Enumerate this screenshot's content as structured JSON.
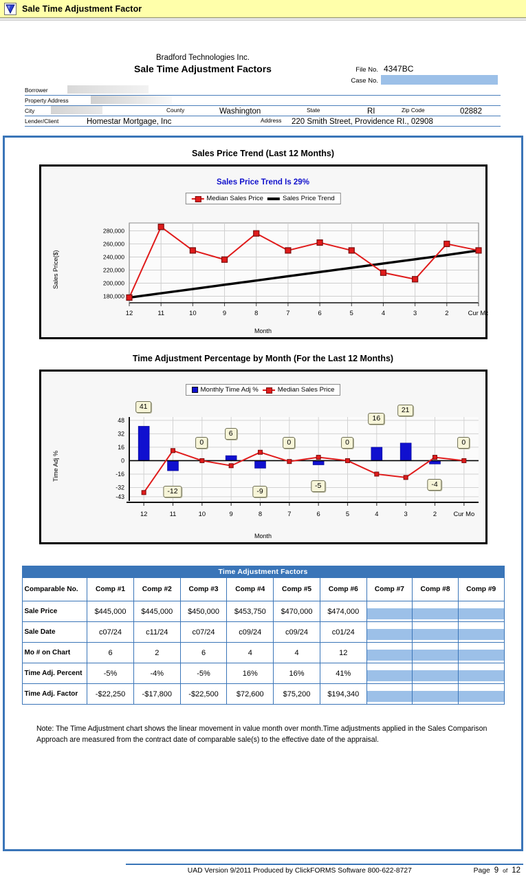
{
  "window": {
    "title": "Sale Time Adjustment Factor",
    "icon": "blue-triangle-icon"
  },
  "header": {
    "company": "Bradford Technologies Inc.",
    "doc_title": "Sale Time Adjustment Factors",
    "file_no_label": "File No.",
    "file_no_value": "4347BC",
    "case_no_label": "Case No.",
    "case_no_value": ""
  },
  "identification": {
    "borrower_label": "Borrower",
    "borrower_value": "",
    "property_address_label": "Property Address",
    "property_address_value": "",
    "city_label": "City",
    "city_value": "",
    "county_label": "County",
    "county_value": "Washington",
    "state_label": "State",
    "state_value": "RI",
    "zip_label": "Zip Code",
    "zip_value": "02882",
    "lender_label": "Lender/Client",
    "lender_value": "Homestar Mortgage, Inc",
    "address_label": "Address",
    "address_value": "220 Smith Street, Providence RI.,  02908"
  },
  "chart_data": [
    {
      "type": "line",
      "title": "Sales Price Trend (Last 12 Months)",
      "annotation": "Sales Price Trend Is 29%",
      "xlabel": "Month",
      "ylabel": "Sales Price($)",
      "categories": [
        "12",
        "11",
        "10",
        "9",
        "8",
        "7",
        "6",
        "5",
        "4",
        "3",
        "2",
        "Cur Mo"
      ],
      "ylim": [
        170000,
        292000
      ],
      "yticks": [
        180000,
        200000,
        220000,
        240000,
        260000,
        280000
      ],
      "ytick_labels": [
        "180,000",
        "200,000",
        "220,000",
        "240,000",
        "260,000",
        "280,000"
      ],
      "grid": true,
      "legend_position": "top-center",
      "series": [
        {
          "name": "Median Sales Price",
          "color": "#e01b1b",
          "marker": "square",
          "values": [
            178000,
            286000,
            250000,
            236000,
            276000,
            250000,
            262000,
            250000,
            216000,
            206000,
            260000,
            250000
          ]
        },
        {
          "name": "Sales Price Trend",
          "color": "#000000",
          "marker": "none",
          "values": [
            178000,
            184500,
            191000,
            197500,
            204000,
            210500,
            217000,
            223500,
            230000,
            236500,
            243000,
            250000
          ]
        }
      ]
    },
    {
      "type": "bar",
      "title": "Time Adjustment Percentage by Month (For the Last 12 Months)",
      "xlabel": "Month",
      "ylabel": "Time Adj %",
      "categories": [
        "12",
        "11",
        "10",
        "9",
        "8",
        "7",
        "6",
        "5",
        "4",
        "3",
        "2",
        "Cur Mo"
      ],
      "ylim": [
        -43,
        48
      ],
      "yticks": [
        48,
        32,
        16,
        0,
        -16,
        -32,
        -43
      ],
      "ytick_labels": [
        "48",
        "32",
        "16",
        "0",
        "-16",
        "-32",
        "-43"
      ],
      "grid": true,
      "legend_position": "top-center",
      "bar_labels": [
        "41",
        "-12",
        "0",
        "6",
        "-9",
        "0",
        "-5",
        "0",
        "16",
        "21",
        "-4",
        "0"
      ],
      "series": [
        {
          "name": "Monthly Time Adj %",
          "color": "#1010cf",
          "values": [
            41,
            -12,
            0,
            6,
            -9,
            0,
            -5,
            0,
            16,
            21,
            -4,
            0
          ]
        },
        {
          "name": "Median Sales Price",
          "color": "#e01b1b",
          "marker": "square",
          "values": [
            -38,
            12,
            0,
            -6,
            10,
            -1,
            4,
            0,
            -16,
            -20,
            4,
            0
          ]
        }
      ]
    }
  ],
  "table": {
    "title": "Time Adjustment Factors",
    "columns": [
      "Comparable No.",
      "Comp #1",
      "Comp #2",
      "Comp #3",
      "Comp #4",
      "Comp #5",
      "Comp #6",
      "Comp #7",
      "Comp #8",
      "Comp #9"
    ],
    "rows": [
      {
        "label": "Sale Price",
        "values": [
          "$445,000",
          "$445,000",
          "$450,000",
          "$453,750",
          "$470,000",
          "$474,000",
          "",
          "",
          ""
        ]
      },
      {
        "label": "Sale Date",
        "values": [
          "c07/24",
          "c11/24",
          "c07/24",
          "c09/24",
          "c09/24",
          "c01/24",
          "",
          "",
          ""
        ]
      },
      {
        "label": "Mo # on Chart",
        "values": [
          "6",
          "2",
          "6",
          "4",
          "4",
          "12",
          "",
          "",
          ""
        ]
      },
      {
        "label": "Time Adj. Percent",
        "values": [
          "-5%",
          "-4%",
          "-5%",
          "16%",
          "16%",
          "41%",
          "",
          "",
          ""
        ]
      },
      {
        "label": "Time Adj. Factor",
        "values": [
          "-$22,250",
          "-$17,800",
          "-$22,500",
          "$72,600",
          "$75,200",
          "$194,340",
          "",
          "",
          ""
        ]
      }
    ]
  },
  "note": {
    "text": "Note: The Time Adjustment chart shows the linear movement in value month over month.Time adjustments applied in the Sales Comparison Approach are measured from the contract date of comparable sale(s) to the effective date of the appraisal."
  },
  "footer": {
    "text": "UAD Version 9/2011 Produced by ClickFORMS Software 800-622-8727",
    "page_label": "Page",
    "page_number": "9",
    "of_label": "of",
    "page_total": "12"
  },
  "colors": {
    "accent_blue": "#3a75b8",
    "title_bar": "#ffffaa",
    "series_red": "#e01b1b",
    "series_blue": "#1010cf",
    "trend_text": "#1111cc"
  }
}
